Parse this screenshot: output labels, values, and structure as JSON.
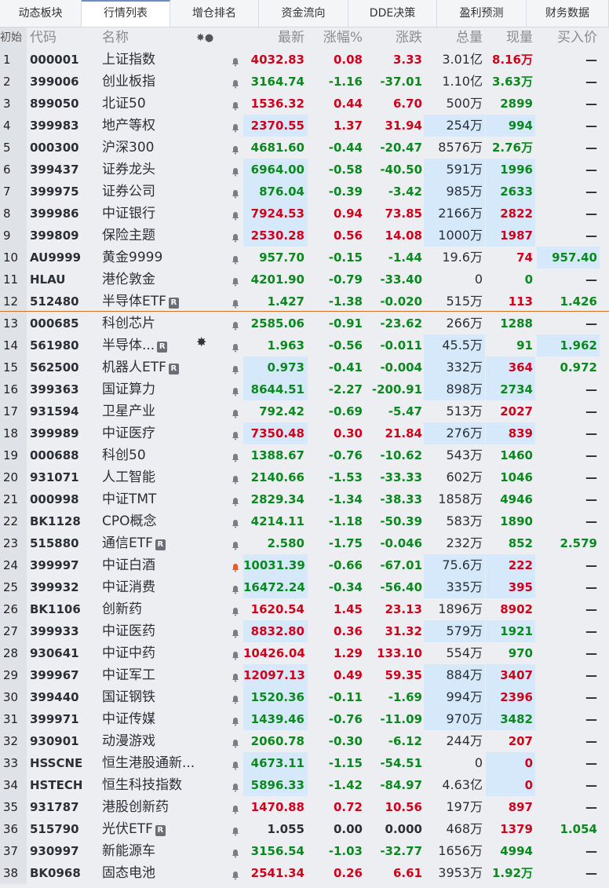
{
  "tabs": [
    {
      "label": "动态板块",
      "active": false
    },
    {
      "label": "行情列表",
      "active": true
    },
    {
      "label": "增仓排名",
      "active": false
    },
    {
      "label": "资金流向",
      "active": false
    },
    {
      "label": "DDE决策",
      "active": false
    },
    {
      "label": "盈利预测",
      "active": false
    },
    {
      "label": "财务数据",
      "active": false
    }
  ],
  "columns": {
    "idx": "初始",
    "code": "代码",
    "name": "名称",
    "mark": "✸●",
    "last": "最新",
    "pct": "涨幅%",
    "chg": "涨跌",
    "vol": "总量",
    "cur": "现量",
    "bid": "买入价"
  },
  "colors": {
    "up": "#d0021b",
    "down": "#0a8a1e",
    "highlight": "#d6e9fb",
    "alert_bell": "#f05a1a"
  },
  "rows": [
    {
      "idx": "1",
      "code": "000001",
      "name": "上证指数",
      "last": "4032.83",
      "pct": "0.08",
      "chg": "3.33",
      "vol": "3.01亿",
      "cur": "8.16万",
      "bid": "—",
      "dir": "up",
      "cur_dir": "up"
    },
    {
      "idx": "2",
      "code": "399006",
      "name": "创业板指",
      "last": "3164.74",
      "pct": "-1.16",
      "chg": "-37.01",
      "vol": "1.10亿",
      "cur": "3.63万",
      "bid": "—",
      "dir": "down",
      "cur_dir": "down"
    },
    {
      "idx": "3",
      "code": "899050",
      "name": "北证50",
      "last": "1536.32",
      "pct": "0.44",
      "chg": "6.70",
      "vol": "500万",
      "cur": "2899",
      "bid": "—",
      "dir": "up",
      "cur_dir": "down"
    },
    {
      "idx": "4",
      "code": "399983",
      "name": "地产等权",
      "last": "2370.55",
      "pct": "1.37",
      "chg": "31.94",
      "vol": "254万",
      "cur": "994",
      "bid": "—",
      "dir": "up",
      "cur_dir": "down",
      "hl_last": true,
      "hl_vol": true,
      "hl_cur": true
    },
    {
      "idx": "5",
      "code": "000300",
      "name": "沪深300",
      "last": "4681.60",
      "pct": "-0.44",
      "chg": "-20.47",
      "vol": "8576万",
      "cur": "2.76万",
      "bid": "—",
      "dir": "down",
      "cur_dir": "down"
    },
    {
      "idx": "6",
      "code": "399437",
      "name": "证券龙头",
      "last": "6964.00",
      "pct": "-0.58",
      "chg": "-40.50",
      "vol": "591万",
      "cur": "1996",
      "bid": "—",
      "dir": "down",
      "cur_dir": "down",
      "hl_last": true,
      "hl_vol": true,
      "hl_cur": true
    },
    {
      "idx": "7",
      "code": "399975",
      "name": "证券公司",
      "last": "876.04",
      "pct": "-0.39",
      "chg": "-3.42",
      "vol": "985万",
      "cur": "2633",
      "bid": "—",
      "dir": "down",
      "cur_dir": "down",
      "hl_last": true,
      "hl_vol": true,
      "hl_cur": true
    },
    {
      "idx": "8",
      "code": "399986",
      "name": "中证银行",
      "last": "7924.53",
      "pct": "0.94",
      "chg": "73.85",
      "vol": "2166万",
      "cur": "2822",
      "bid": "—",
      "dir": "up",
      "cur_dir": "up",
      "hl_last": true,
      "hl_vol": true,
      "hl_cur": true
    },
    {
      "idx": "9",
      "code": "399809",
      "name": "保险主题",
      "last": "2530.28",
      "pct": "0.56",
      "chg": "14.08",
      "vol": "1000万",
      "cur": "1987",
      "bid": "—",
      "dir": "up",
      "cur_dir": "up",
      "hl_last": true,
      "hl_vol": true,
      "hl_cur": true
    },
    {
      "idx": "10",
      "code": "AU9999",
      "name": "黄金9999",
      "last": "957.70",
      "pct": "-0.15",
      "chg": "-1.44",
      "vol": "19.6万",
      "cur": "74",
      "bid": "957.40",
      "dir": "down",
      "cur_dir": "up",
      "bid_dir": "down",
      "hl_bid": true
    },
    {
      "idx": "11",
      "code": "HLAU",
      "name": "港伦敦金",
      "last": "4201.90",
      "pct": "-0.79",
      "chg": "-33.40",
      "vol": "0",
      "cur": "0",
      "bid": "—",
      "dir": "down",
      "cur_dir": "down"
    },
    {
      "idx": "12",
      "code": "512480",
      "name": "半导体ETF",
      "badge": "R",
      "last": "1.427",
      "pct": "-1.38",
      "chg": "-0.020",
      "vol": "515万",
      "cur": "113",
      "bid": "1.426",
      "dir": "down",
      "cur_dir": "up",
      "bid_dir": "down"
    },
    {
      "idx": "13",
      "code": "000685",
      "name": "科创芯片",
      "last": "2585.06",
      "pct": "-0.91",
      "chg": "-23.62",
      "vol": "266万",
      "cur": "1288",
      "bid": "—",
      "dir": "down",
      "cur_dir": "down"
    },
    {
      "idx": "14",
      "code": "561980",
      "name": "半导体...",
      "badge": "R",
      "star": true,
      "last": "1.963",
      "pct": "-0.56",
      "chg": "-0.011",
      "vol": "45.5万",
      "cur": "91",
      "bid": "1.962",
      "dir": "down",
      "cur_dir": "down",
      "bid_dir": "down",
      "hl_vol": true,
      "hl_bid": true
    },
    {
      "idx": "15",
      "code": "562500",
      "name": "机器人ETF",
      "badge": "R",
      "last": "0.973",
      "pct": "-0.41",
      "chg": "-0.004",
      "vol": "332万",
      "cur": "364",
      "bid": "0.972",
      "dir": "down",
      "cur_dir": "up",
      "bid_dir": "down",
      "hl_last": true,
      "hl_vol": true,
      "hl_cur": true
    },
    {
      "idx": "16",
      "code": "399363",
      "name": "国证算力",
      "last": "8644.51",
      "pct": "-2.27",
      "chg": "-200.91",
      "vol": "898万",
      "cur": "2734",
      "bid": "—",
      "dir": "down",
      "cur_dir": "down",
      "hl_last": true,
      "hl_vol": true,
      "hl_cur": true
    },
    {
      "idx": "17",
      "code": "931594",
      "name": "卫星产业",
      "last": "792.42",
      "pct": "-0.69",
      "chg": "-5.47",
      "vol": "513万",
      "cur": "2027",
      "bid": "—",
      "dir": "down",
      "cur_dir": "up"
    },
    {
      "idx": "18",
      "code": "399989",
      "name": "中证医疗",
      "last": "7350.48",
      "pct": "0.30",
      "chg": "21.84",
      "vol": "276万",
      "cur": "839",
      "bid": "—",
      "dir": "up",
      "cur_dir": "up",
      "hl_last": true,
      "hl_vol": true,
      "hl_cur": true
    },
    {
      "idx": "19",
      "code": "000688",
      "name": "科创50",
      "last": "1388.67",
      "pct": "-0.76",
      "chg": "-10.62",
      "vol": "543万",
      "cur": "1460",
      "bid": "—",
      "dir": "down",
      "cur_dir": "down"
    },
    {
      "idx": "20",
      "code": "931071",
      "name": "人工智能",
      "last": "2140.66",
      "pct": "-1.53",
      "chg": "-33.33",
      "vol": "602万",
      "cur": "1046",
      "bid": "—",
      "dir": "down",
      "cur_dir": "down"
    },
    {
      "idx": "21",
      "code": "000998",
      "name": "中证TMT",
      "last": "2829.34",
      "pct": "-1.34",
      "chg": "-38.33",
      "vol": "1858万",
      "cur": "4946",
      "bid": "—",
      "dir": "down",
      "cur_dir": "down"
    },
    {
      "idx": "22",
      "code": "BK1128",
      "name": "CPO概念",
      "last": "4214.11",
      "pct": "-1.18",
      "chg": "-50.39",
      "vol": "583万",
      "cur": "1890",
      "bid": "—",
      "dir": "down",
      "cur_dir": "down"
    },
    {
      "idx": "23",
      "code": "515880",
      "name": "通信ETF",
      "badge": "R",
      "last": "2.580",
      "pct": "-1.75",
      "chg": "-0.046",
      "vol": "232万",
      "cur": "852",
      "bid": "2.579",
      "dir": "down",
      "cur_dir": "down",
      "bid_dir": "down"
    },
    {
      "idx": "24",
      "code": "399997",
      "name": "中证白酒",
      "bell_alert": true,
      "last": "10031.39",
      "pct": "-0.66",
      "chg": "-67.01",
      "vol": "75.6万",
      "cur": "222",
      "bid": "—",
      "dir": "down",
      "cur_dir": "up",
      "hl_last": true,
      "hl_vol": true,
      "hl_cur": true
    },
    {
      "idx": "25",
      "code": "399932",
      "name": "中证消费",
      "last": "16472.24",
      "pct": "-0.34",
      "chg": "-56.40",
      "vol": "335万",
      "cur": "395",
      "bid": "—",
      "dir": "down",
      "cur_dir": "up",
      "hl_last": true,
      "hl_vol": true,
      "hl_cur": true
    },
    {
      "idx": "26",
      "code": "BK1106",
      "name": "创新药",
      "last": "1620.54",
      "pct": "1.45",
      "chg": "23.13",
      "vol": "1896万",
      "cur": "8902",
      "bid": "—",
      "dir": "up",
      "cur_dir": "up"
    },
    {
      "idx": "27",
      "code": "399933",
      "name": "中证医药",
      "last": "8832.80",
      "pct": "0.36",
      "chg": "31.32",
      "vol": "579万",
      "cur": "1921",
      "bid": "—",
      "dir": "up",
      "cur_dir": "down",
      "hl_last": true,
      "hl_vol": true,
      "hl_cur": true
    },
    {
      "idx": "28",
      "code": "930641",
      "name": "中证中药",
      "last": "10426.04",
      "pct": "1.29",
      "chg": "133.10",
      "vol": "554万",
      "cur": "970",
      "bid": "—",
      "dir": "up",
      "cur_dir": "down"
    },
    {
      "idx": "29",
      "code": "399967",
      "name": "中证军工",
      "last": "12097.13",
      "pct": "0.49",
      "chg": "59.35",
      "vol": "884万",
      "cur": "3407",
      "bid": "—",
      "dir": "up",
      "cur_dir": "up",
      "hl_last": true,
      "hl_vol": true,
      "hl_cur": true
    },
    {
      "idx": "30",
      "code": "399440",
      "name": "国证钢铁",
      "last": "1520.36",
      "pct": "-0.11",
      "chg": "-1.69",
      "vol": "994万",
      "cur": "2396",
      "bid": "—",
      "dir": "down",
      "cur_dir": "up",
      "hl_last": true,
      "hl_vol": true,
      "hl_cur": true
    },
    {
      "idx": "31",
      "code": "399971",
      "name": "中证传媒",
      "last": "1439.46",
      "pct": "-0.76",
      "chg": "-11.09",
      "vol": "970万",
      "cur": "3482",
      "bid": "—",
      "dir": "down",
      "cur_dir": "down",
      "hl_last": true,
      "hl_vol": true,
      "hl_cur": true
    },
    {
      "idx": "32",
      "code": "930901",
      "name": "动漫游戏",
      "last": "2060.78",
      "pct": "-0.30",
      "chg": "-6.12",
      "vol": "244万",
      "cur": "207",
      "bid": "—",
      "dir": "down",
      "cur_dir": "up"
    },
    {
      "idx": "33",
      "code": "HSSCNE",
      "name": "恒生港股通新...",
      "last": "4673.11",
      "pct": "-1.15",
      "chg": "-54.51",
      "vol": "0",
      "cur": "0",
      "bid": "—",
      "dir": "down",
      "cur_dir": "up",
      "hl_last": true,
      "hl_cur": true
    },
    {
      "idx": "34",
      "code": "HSTECH",
      "name": "恒生科技指数",
      "last": "5896.33",
      "pct": "-1.42",
      "chg": "-84.97",
      "vol": "4.63亿",
      "cur": "0",
      "bid": "—",
      "dir": "down",
      "cur_dir": "up",
      "hl_last": true,
      "hl_cur": true
    },
    {
      "idx": "35",
      "code": "931787",
      "name": "港股创新药",
      "last": "1470.88",
      "pct": "0.72",
      "chg": "10.56",
      "vol": "197万",
      "cur": "897",
      "bid": "—",
      "dir": "up",
      "cur_dir": "up"
    },
    {
      "idx": "36",
      "code": "515790",
      "name": "光伏ETF",
      "badge": "R",
      "last": "1.055",
      "pct": "0.00",
      "chg": "0.000",
      "vol": "468万",
      "cur": "1379",
      "bid": "1.054",
      "dir": "flat",
      "cur_dir": "up",
      "bid_dir": "down"
    },
    {
      "idx": "37",
      "code": "930997",
      "name": "新能源车",
      "last": "3156.54",
      "pct": "-1.03",
      "chg": "-32.77",
      "vol": "1656万",
      "cur": "4994",
      "bid": "—",
      "dir": "down",
      "cur_dir": "down"
    },
    {
      "idx": "38",
      "code": "BK0968",
      "name": "固态电池",
      "last": "2541.34",
      "pct": "0.26",
      "chg": "6.61",
      "vol": "3953万",
      "cur": "1.92万",
      "bid": "—",
      "dir": "up",
      "cur_dir": "down"
    }
  ]
}
